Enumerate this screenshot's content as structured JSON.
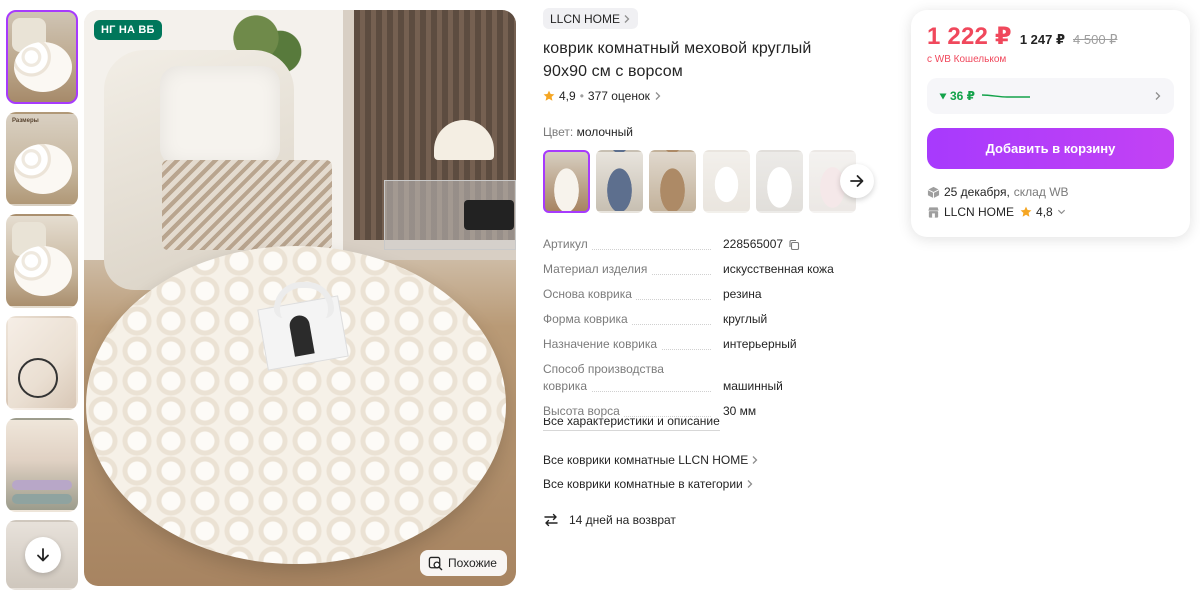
{
  "gallery": {
    "badge": "НГ НА ВБ",
    "similar_label": "Похожие",
    "thumb_label": "Размеры"
  },
  "product": {
    "brand": "LLCN HOME",
    "title_line1": "коврик комнатный меховой круглый",
    "title_line2": "90х90 см с ворсом",
    "rating": "4,9",
    "reviews": "377 оценок",
    "color_label": "Цвет:",
    "color_value": "молочный"
  },
  "specs": [
    {
      "key": "Артикул",
      "value": "228565007"
    },
    {
      "key": "Материал изделия",
      "value": "искусственная кожа"
    },
    {
      "key": "Основа коврика",
      "value": "резина"
    },
    {
      "key": "Форма коврика",
      "value": "круглый"
    },
    {
      "key": "Назначение коврика",
      "value": "интерьерный"
    },
    {
      "key_line1": "Способ производства",
      "key_line2": "коврика",
      "value": "машинный"
    },
    {
      "key": "Высота ворса",
      "value": "30 мм"
    }
  ],
  "links": {
    "all_specs": "Все характеристики и описание",
    "brand_rugs": "Все коврики комнатные LLCN HOME",
    "category_rugs": "Все коврики комнатные в категории",
    "returns": "14 дней на возврат"
  },
  "price_card": {
    "price": "1 222 ₽",
    "regular_price": "1 247 ₽",
    "old_price": "4 500 ₽",
    "wallet_note": "с WB Кошельком",
    "trend_value": "36 ₽",
    "add_to_cart": "Добавить в корзину",
    "delivery_date": "25 декабря,",
    "warehouse": "склад WB",
    "seller_name": "LLCN HOME",
    "seller_rating": "4,8"
  },
  "colors": {
    "accent": "#a73afd",
    "price": "#f0485c",
    "trend": "#13a24a",
    "badge": "#00775b",
    "star": "#f5a623"
  }
}
